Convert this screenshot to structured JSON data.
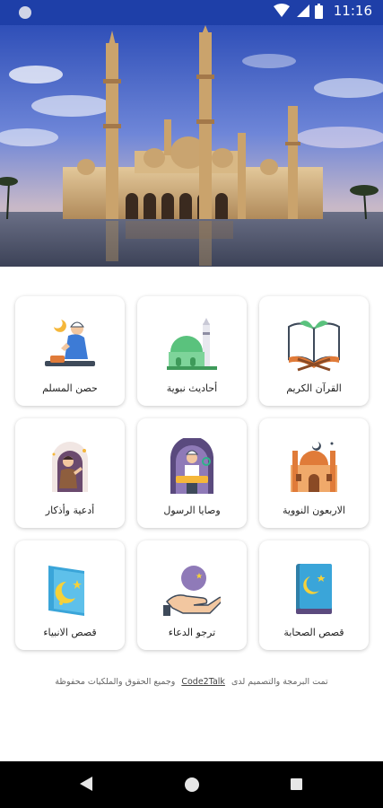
{
  "status_bar": {
    "time": "11:16"
  },
  "hero": {
    "alt_name": "mosque-photo"
  },
  "menu": [
    {
      "label": "حصن المسلم",
      "icon": "praying-man-icon"
    },
    {
      "label": "أحاديث نبوية",
      "icon": "mosque-dome-icon"
    },
    {
      "label": "القرآن الكريم",
      "icon": "quran-book-icon"
    },
    {
      "label": "أدعية وأذكار",
      "icon": "praying-figure-icon"
    },
    {
      "label": "وصايا الرسول",
      "icon": "imam-pulpit-icon"
    },
    {
      "label": "الاربعون النووية",
      "icon": "mosque-building-icon"
    },
    {
      "label": "قصص الانبياء",
      "icon": "crescent-card-icon"
    },
    {
      "label": "ترجو الدعاء",
      "icon": "hand-moon-icon"
    },
    {
      "label": "قصص الصحابة",
      "icon": "crescent-book-icon"
    }
  ],
  "footer": {
    "text_before": "تمت البرمجة والتصميم لدى",
    "link": "Code2Talk",
    "text_after": "وجميع الحقوق والملكيات محفوظة"
  },
  "colors": {
    "status_bar": "#1e3fa8",
    "nav_bar": "#000000"
  }
}
